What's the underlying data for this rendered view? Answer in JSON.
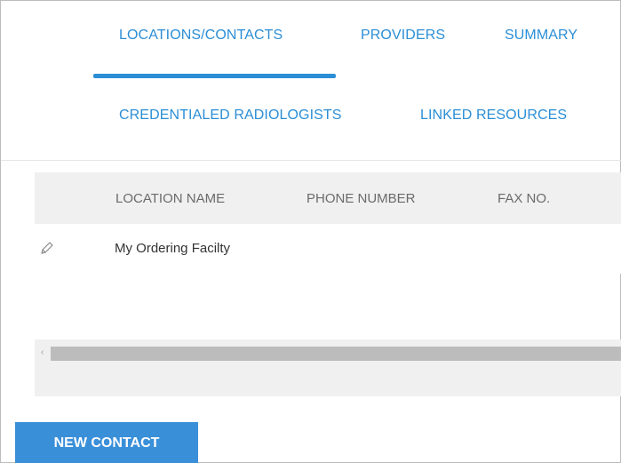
{
  "tabs": {
    "row1": [
      {
        "label": "LOCATIONS/CONTACTS",
        "active": true
      },
      {
        "label": "PROVIDERS",
        "active": false
      },
      {
        "label": "SUMMARY",
        "active": false
      }
    ],
    "row2": [
      {
        "label": "CREDENTIALED RADIOLOGISTS",
        "active": false
      },
      {
        "label": "LINKED RESOURCES",
        "active": false
      }
    ]
  },
  "grid": {
    "columns": [
      "LOCATION NAME",
      "PHONE NUMBER",
      "FAX NO."
    ],
    "rows": [
      {
        "location_name": "My Ordering Facilty",
        "phone_number": "",
        "fax_no": ""
      }
    ]
  },
  "scrollbar": {
    "arrow": "‹"
  },
  "actions": {
    "new_contact_label": "NEW CONTACT"
  },
  "icons": {
    "edit": "pencil-icon"
  },
  "colors": {
    "accent": "#2b8ed6",
    "button": "#3a8fd9",
    "header_bg": "#f0f0f0"
  }
}
